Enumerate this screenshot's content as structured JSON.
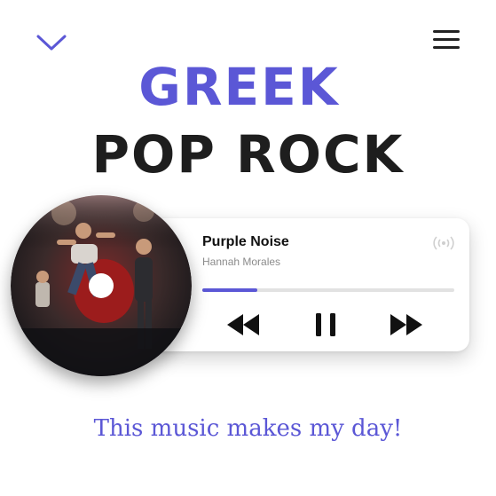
{
  "header": {
    "collapse_icon": "chevron-down-icon",
    "menu_icon": "hamburger-menu-icon"
  },
  "title": {
    "line1": "GREEK",
    "line2": "POP ROCK"
  },
  "player": {
    "track_title": "Purple Noise",
    "artist": "Hannah Morales",
    "progress": 0.22,
    "controls": {
      "rewind_icon": "rewind-icon",
      "pause_icon": "pause-icon",
      "forward_icon": "fast-forward-icon",
      "cast_icon": "broadcast-icon"
    }
  },
  "tagline": "This music makes my day!",
  "colors": {
    "accent": "#5b57d6",
    "heading": "#1e1e1e"
  }
}
